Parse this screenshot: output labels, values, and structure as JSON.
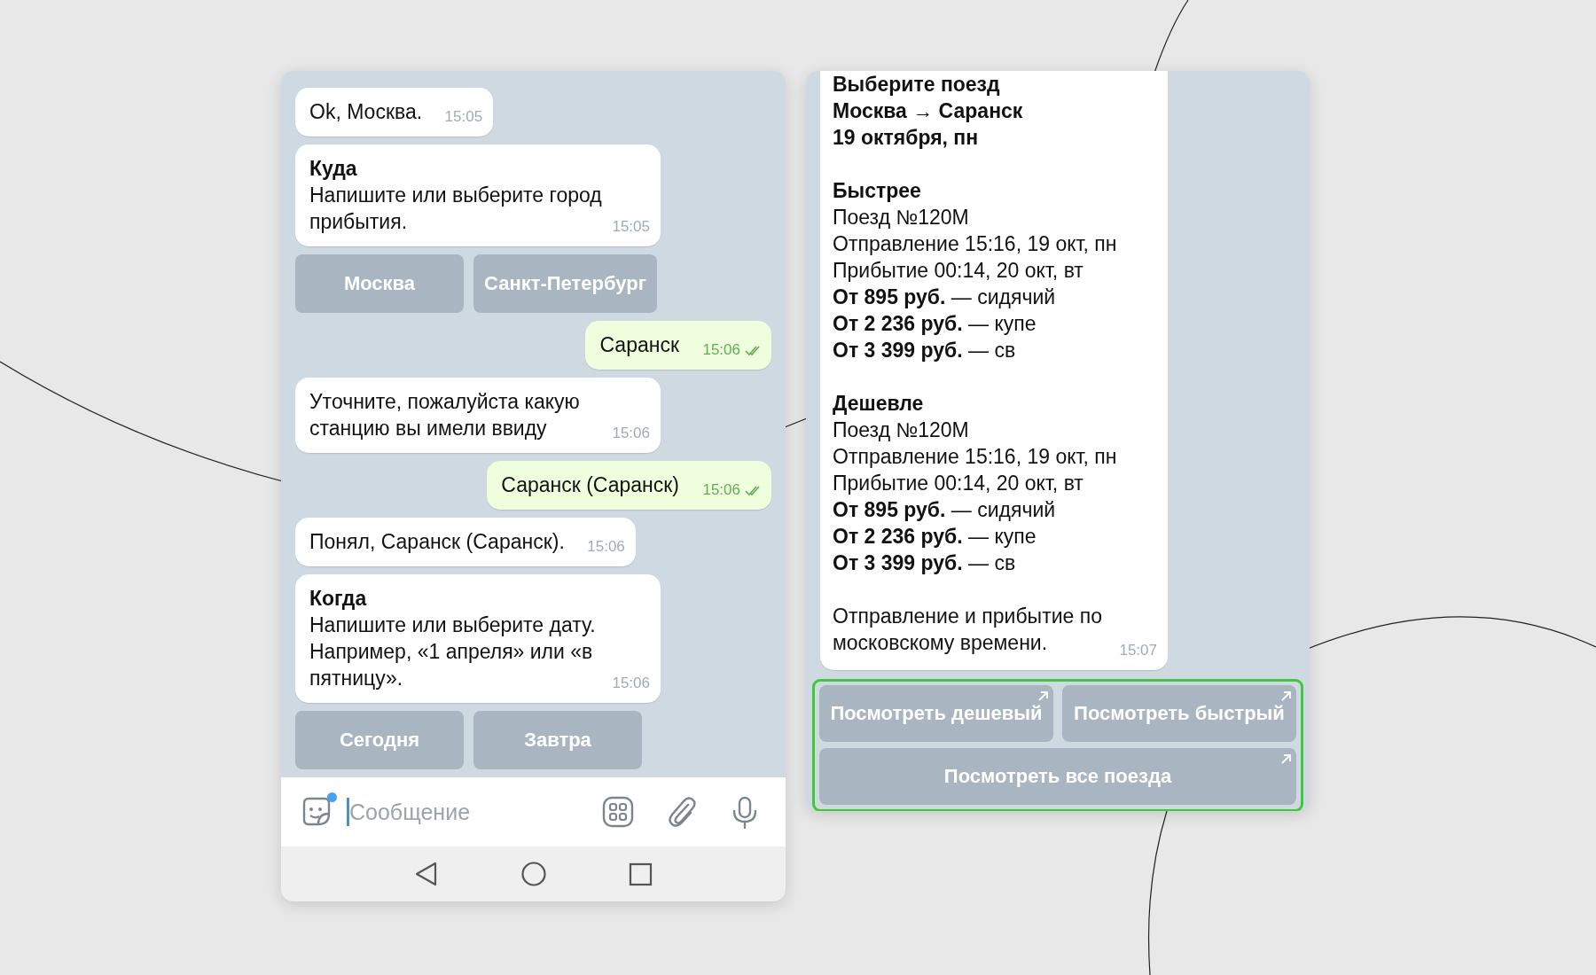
{
  "left_phone": {
    "messages": [
      {
        "kind": "incoming",
        "body": "Ok, Москва.",
        "time": "15:05"
      },
      {
        "kind": "incoming",
        "title": "Куда",
        "body": "Напишите или выберите город прибытия.",
        "time": "15:05"
      },
      {
        "kind": "keyboard",
        "highlighted": false,
        "rows": [
          [
            {
              "label": "Москва",
              "link": false
            },
            {
              "label": "Санкт-Петербург",
              "link": false
            }
          ]
        ]
      },
      {
        "kind": "outgoing",
        "body": "Саранск",
        "time": "15:06",
        "read": true
      },
      {
        "kind": "incoming",
        "body": "Уточните, пожалуйста какую станцию вы имели ввиду",
        "time": "15:06"
      },
      {
        "kind": "outgoing",
        "body": "Саранск (Саранск)",
        "time": "15:06",
        "read": true
      },
      {
        "kind": "incoming",
        "body": "Понял, Саранск (Саранск).",
        "time": "15:06"
      },
      {
        "kind": "incoming",
        "title": "Когда",
        "body": "Напишите или выберите дату. Например, «1 апреля» или «в пятницу».",
        "time": "15:06"
      },
      {
        "kind": "keyboard",
        "highlighted": false,
        "rows": [
          [
            {
              "label": "Сегодня",
              "link": false
            },
            {
              "label": "Завтра",
              "link": false
            }
          ]
        ]
      }
    ],
    "composer": {
      "placeholder": "Сообщение",
      "unread_stickers": true
    }
  },
  "right_phone": {
    "messages": [
      {
        "kind": "info",
        "time": "15:07",
        "paragraphs": [
          [
            {
              "text": "Выберите поезд",
              "bold": true
            },
            {
              "text": "Москва → Саранск",
              "bold": true
            },
            {
              "text": "19 октября, пн",
              "bold": true
            }
          ],
          [
            {
              "text": "Быстрее",
              "bold": true
            },
            {
              "text": "Поезд №120М",
              "bold": false
            },
            {
              "text": "Отправление 15:16, 19 окт, пн",
              "bold": false
            },
            {
              "text": "Прибытие 00:14, 20 окт, вт",
              "bold": false
            },
            {
              "text": "**От 895 руб.** — сидячий",
              "bold": false
            },
            {
              "text": "**От 2 236 руб.** — купе",
              "bold": false
            },
            {
              "text": "**От 3 399 руб.** — св",
              "bold": false
            }
          ],
          [
            {
              "text": "Дешевле",
              "bold": true
            },
            {
              "text": "Поезд №120М",
              "bold": false
            },
            {
              "text": "Отправление 15:16, 19 окт, пн",
              "bold": false
            },
            {
              "text": "Прибытие 00:14, 20 окт, вт",
              "bold": false
            },
            {
              "text": "**От 895 руб.** — сидячий",
              "bold": false
            },
            {
              "text": "**От 2 236 руб.** — купе",
              "bold": false
            },
            {
              "text": "**От 3 399 руб.** — св",
              "bold": false
            }
          ],
          [
            {
              "text": "Отправление и прибытие по",
              "bold": false
            },
            {
              "text": "московскому времени.",
              "bold": false
            }
          ]
        ]
      },
      {
        "kind": "keyboard",
        "highlighted": true,
        "rows": [
          [
            {
              "label": "Посмотреть дешевый",
              "link": true
            },
            {
              "label": "Посмотреть быстрый",
              "link": true
            }
          ],
          [
            {
              "label": "Посмотреть все поезда",
              "link": true
            }
          ]
        ]
      }
    ]
  }
}
